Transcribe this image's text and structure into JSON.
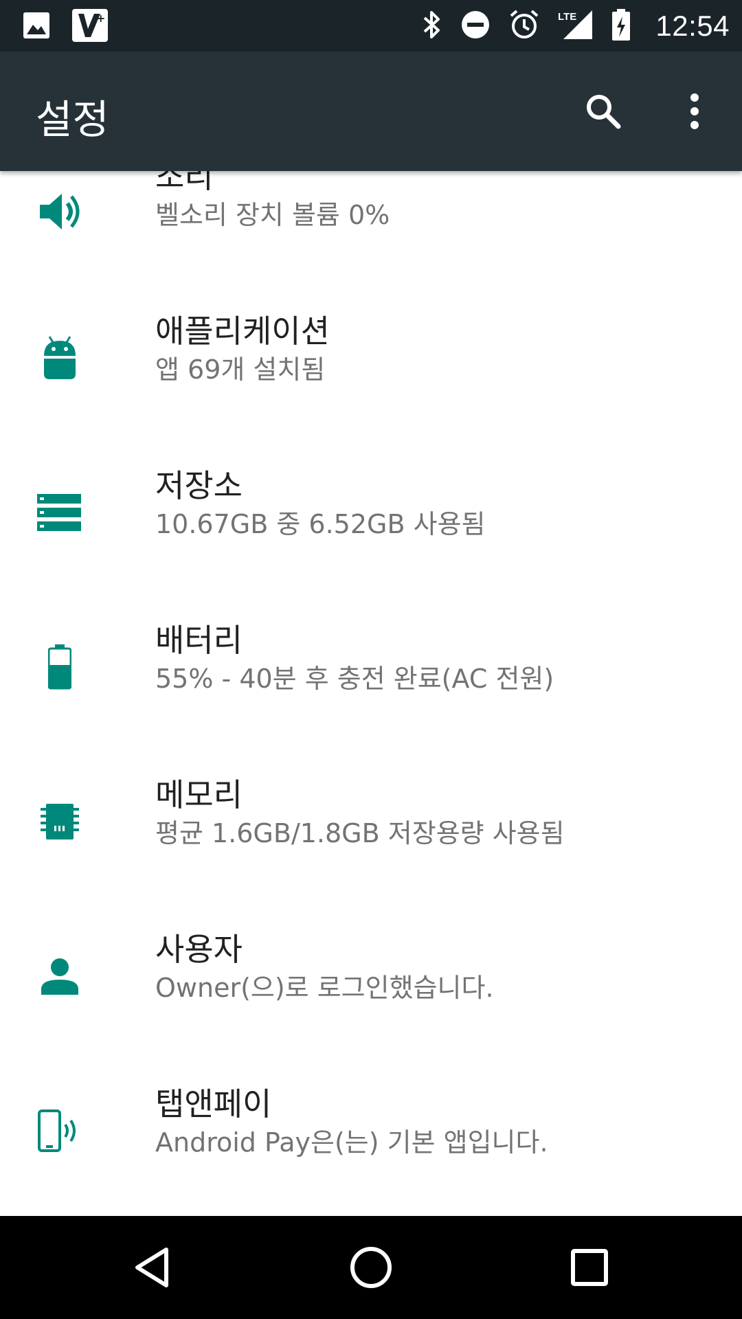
{
  "status_bar": {
    "time": "12:54",
    "left_icons": [
      "image-icon",
      "app-badge-icon"
    ],
    "right_icons": [
      "bluetooth-icon",
      "do-not-disturb-icon",
      "alarm-icon",
      "lte-signal-icon",
      "battery-charging-icon"
    ],
    "network_label": "LTE"
  },
  "app_bar": {
    "title": "설정",
    "actions": [
      "search-icon",
      "more-vert-icon"
    ]
  },
  "accent_color": "#00897b",
  "settings": [
    {
      "id": "sound",
      "icon": "volume-icon",
      "title": "소리",
      "summary": "벨소리 장치 볼륨 0%"
    },
    {
      "id": "apps",
      "icon": "android-icon",
      "title": "애플리케이션",
      "summary": "앱 69개 설치됨"
    },
    {
      "id": "storage",
      "icon": "storage-icon",
      "title": "저장소",
      "summary": "10.67GB 중 6.52GB 사용됨"
    },
    {
      "id": "battery",
      "icon": "battery-icon",
      "title": "배터리",
      "summary": "55% - 40분 후 충전 완료(AC 전원)"
    },
    {
      "id": "memory",
      "icon": "memory-chip-icon",
      "title": "메모리",
      "summary": "평균 1.6GB/1.8GB 저장용량 사용됨"
    },
    {
      "id": "users",
      "icon": "person-icon",
      "title": "사용자",
      "summary": "Owner(으)로 로그인했습니다."
    },
    {
      "id": "tap-pay",
      "icon": "nfc-phone-icon",
      "title": "탭앤페이",
      "summary": "Android Pay은(는) 기본 앱입니다."
    }
  ],
  "nav_bar": {
    "buttons": [
      "back-icon",
      "home-icon",
      "recents-icon"
    ]
  }
}
